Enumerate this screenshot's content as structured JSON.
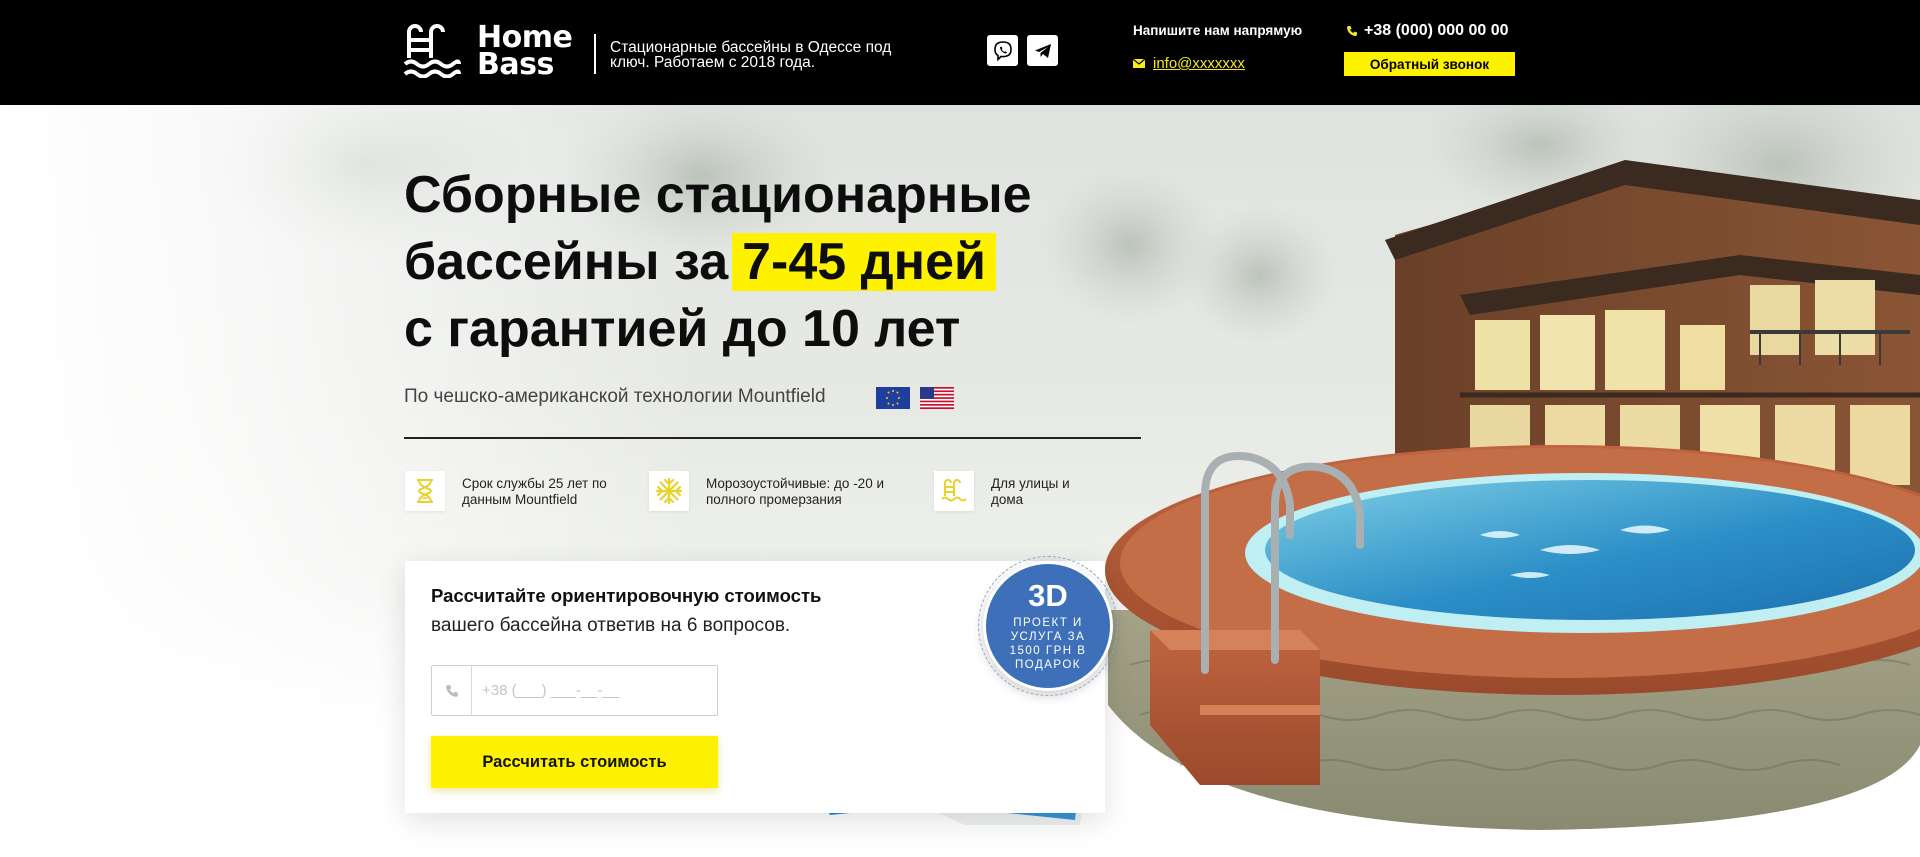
{
  "header": {
    "logo_text_1": "Home",
    "logo_text_2": "Bass",
    "tagline": "Стационарные бассейны в Одессе под ключ. Работаем с 2018 года.",
    "write_label": "Напишите нам напрямую",
    "email": "info@xxxxxxx",
    "phone": "+38 (000) 000 00 00",
    "callback_label": "Обратный звонок",
    "social_icons": [
      "viber-icon",
      "telegram-icon"
    ]
  },
  "hero": {
    "headline_line1": "Сборные стационарные",
    "headline_line2_prefix": "бассейны за",
    "headline_highlight": "7-45 дней",
    "headline_line3": "с гарантией до 10 лет",
    "subtitle": "По чешско-американской технологии Mountfield",
    "flags": [
      "eu-flag-icon",
      "us-flag-icon"
    ]
  },
  "features": [
    {
      "icon": "hourglass-icon",
      "text": "Срок службы 25 лет по данным Mountfield"
    },
    {
      "icon": "snowflake-icon",
      "text": "Морозоустойчивые: до -20 и полного промерзания"
    },
    {
      "icon": "pool-ladder-icon",
      "text": "Для улицы и дома"
    }
  ],
  "calc": {
    "title": "Рассчитайте ориентировочную стоимость",
    "subtitle": "вашего бассейна ответив на 6 вопросов.",
    "phone_placeholder": "+38 (___) ___-__-__",
    "button_label": "Рассчитать стоимость"
  },
  "badge": {
    "big": "3D",
    "small": "ПРОЕКТ И УСЛУГА ЗА 1500 ГРН В ПОДАРОК"
  },
  "colors": {
    "accent_yellow": "#fff200",
    "header_bg": "#000000",
    "badge_blue": "#3d70b8"
  }
}
